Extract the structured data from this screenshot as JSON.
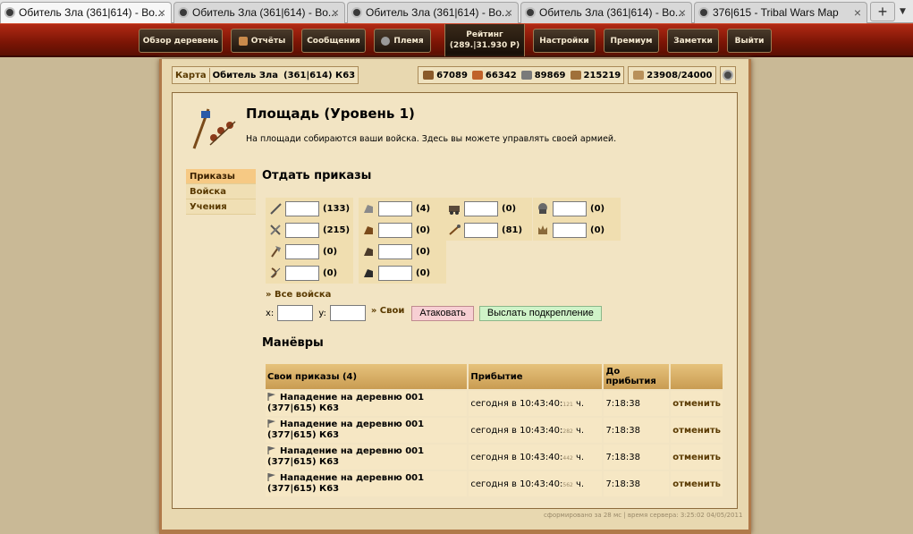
{
  "browser": {
    "tabs": [
      {
        "title": "Обитель Зла (361|614) - Во...",
        "active": true
      },
      {
        "title": "Обитель Зла (361|614) - Во...",
        "active": false
      },
      {
        "title": "Обитель Зла (361|614) - Во...",
        "active": false
      },
      {
        "title": "Обитель Зла (361|614) - Во...",
        "active": false
      },
      {
        "title": "376|615 - Tribal Wars Map",
        "active": false
      }
    ],
    "new_tab": "+"
  },
  "menu": {
    "items": [
      "Обзор деревень",
      "Отчёты",
      "Сообщения",
      "Племя",
      "Настройки",
      "Премиум",
      "Заметки",
      "Выйти"
    ],
    "rating_label": "Рейтинг",
    "rating_value": "(289.|31.930 Р)"
  },
  "topbar": {
    "map_label": "Карта",
    "village": "Обитель Зла",
    "coords": "(361|614) К63",
    "wood": "67089",
    "clay": "66342",
    "iron": "89869",
    "storage": "215219",
    "population": "23908/24000"
  },
  "page": {
    "title": "Площадь (Уровень 1)",
    "description": "На площади собираются ваши войска. Здесь вы можете управлять своей армией."
  },
  "sidemenu": {
    "items": [
      "Приказы",
      "Войска",
      "Учения"
    ]
  },
  "orders": {
    "heading": "Отдать приказы",
    "units": {
      "col1": [
        {
          "name": "spear-icon",
          "count": "(133)"
        },
        {
          "name": "sword-icon",
          "count": "(215)"
        },
        {
          "name": "axe-icon",
          "count": "(0)"
        },
        {
          "name": "archer-icon",
          "count": "(0)"
        }
      ],
      "col2": [
        {
          "name": "spy-icon",
          "count": "(4)"
        },
        {
          "name": "light-cavalry-icon",
          "count": "(0)"
        },
        {
          "name": "mounted-archer-icon",
          "count": "(0)"
        },
        {
          "name": "heavy-cavalry-icon",
          "count": "(0)"
        }
      ],
      "col3": [
        {
          "name": "ram-icon",
          "count": "(0)"
        },
        {
          "name": "catapult-icon",
          "count": "(81)"
        }
      ],
      "col4": [
        {
          "name": "paladin-icon",
          "count": "(0)"
        },
        {
          "name": "noble-icon",
          "count": "(0)"
        }
      ]
    },
    "all_troops": "» Все войска",
    "x_label": "x:",
    "y_label": "y:",
    "own_link": "» Свои",
    "attack_button": "Атаковать",
    "support_button": "Выслать подкрепление"
  },
  "maneuvers": {
    "heading": "Манёвры",
    "columns": [
      "Свои приказы (4)",
      "Прибытие",
      "До прибытия",
      ""
    ],
    "rows": [
      {
        "command": "Нападение на деревню 001 (377|615) К63",
        "arrival": "сегодня в 10:43:40:",
        "ms": "121",
        "unit": "ч.",
        "remaining": "7:18:38",
        "action": "отменить"
      },
      {
        "command": "Нападение на деревню 001 (377|615) К63",
        "arrival": "сегодня в 10:43:40:",
        "ms": "282",
        "unit": "ч.",
        "remaining": "7:18:38",
        "action": "отменить"
      },
      {
        "command": "Нападение на деревню 001 (377|615) К63",
        "arrival": "сегодня в 10:43:40:",
        "ms": "442",
        "unit": "ч.",
        "remaining": "7:18:38",
        "action": "отменить"
      },
      {
        "command": "Нападение на деревню 001 (377|615) К63",
        "arrival": "сегодня в 10:43:40:",
        "ms": "562",
        "unit": "ч.",
        "remaining": "7:18:38",
        "action": "отменить"
      }
    ]
  },
  "footer": "сформировано за 28 мс | время сервера: 3:25:02 04/05/2011",
  "colors": {
    "menu_red": "#7a1505",
    "parchment": "#f2e4c3",
    "header_gold": "#c99c52",
    "attack": "#f7cfd3",
    "support": "#cff3c8"
  }
}
